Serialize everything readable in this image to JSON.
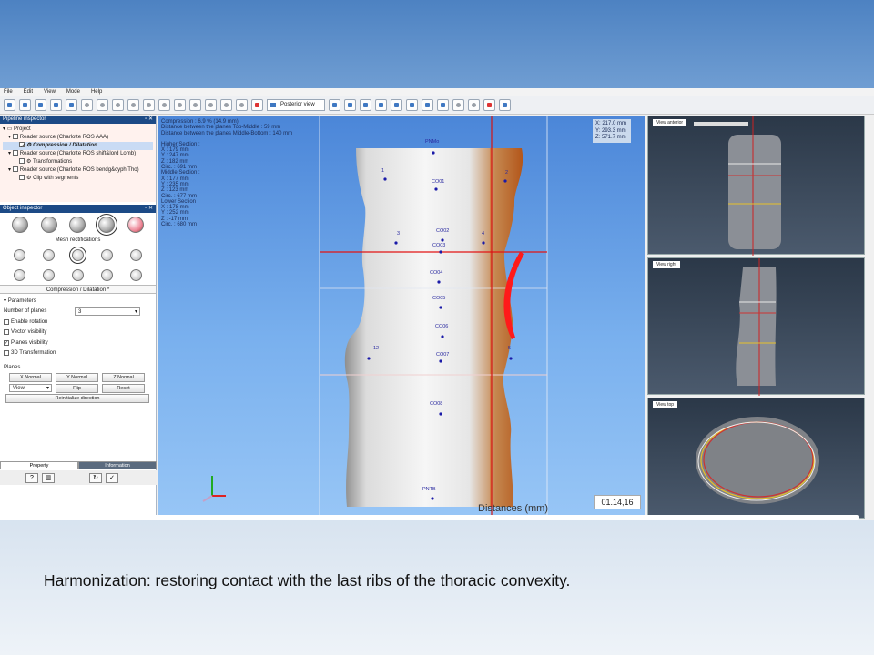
{
  "menubar": [
    "File",
    "Edit",
    "View",
    "Mode",
    "Help"
  ],
  "toolbar": {
    "view_select": "Posterior view"
  },
  "pipeline": {
    "title": "Pipeline inspector",
    "items": [
      {
        "label": "Project"
      },
      {
        "label": "Reader source (Charlotte ROS AAA)"
      },
      {
        "label": "Compression / Dilatation"
      },
      {
        "label": "Reader source (Charlotte ROS shift&lord Lomb)"
      },
      {
        "label": "Transformations"
      },
      {
        "label": "Reader source (Charlotte ROS bendg&cyph Tho)"
      },
      {
        "label": "Clip with segments"
      }
    ]
  },
  "object": {
    "title": "Object inspector",
    "mesh_label": "Mesh rectifications",
    "section_title": "Compression / Dilatation *",
    "parameters_label": "Parameters",
    "num_planes_label": "Number of planes",
    "num_planes_value": "3",
    "checks": [
      {
        "label": "Enable rotation",
        "checked": false
      },
      {
        "label": "Vector visibility",
        "checked": false
      },
      {
        "label": "Planes visibility",
        "checked": true
      },
      {
        "label": "3D Transformation",
        "checked": false
      }
    ],
    "planes_label": "Planes",
    "x_normal": "X Normal",
    "y_normal": "Y Normal",
    "z_normal": "Z Normal",
    "view_combo": "View",
    "flip": "Flip",
    "reset": "Reset",
    "reinit": "Reinitialize direction",
    "tab_property": "Property",
    "tab_information": "Information"
  },
  "overlay": {
    "lines": [
      "Compression : 6.9 % (14.9 mm)",
      "Distance between the planes Top-Middle : 59 mm",
      "Distance between the planes Middle-Bottom : 140 mm",
      "",
      "Higher Section :",
      "  X : 179 mm",
      "  Y : 247 mm",
      "  Z : 182 mm",
      "  Circ. : 691 mm",
      "Middle Section :",
      "  X : 177 mm",
      "  Y : 235 mm",
      "  Z : 123 mm",
      "  Circ. : 677 mm",
      "Lower Section :",
      "  X : 178 mm",
      "  Y : 252 mm",
      "  Z : -17 mm",
      "  Circ. : 680 mm"
    ]
  },
  "coords": {
    "x": "X: 217.0 mm",
    "y": "Y: 293.3 mm",
    "z": "Z: 571.7 mm"
  },
  "landmarks": {
    "pnm": "PNMo",
    "c0d1": "CO01",
    "c0d2": "CO02",
    "c0d3": "CO03",
    "c0d4": "CO04",
    "c0d5": "CO05",
    "c0d6": "CO06",
    "c0d7": "CO07",
    "c0d8": "CO08",
    "pntb": "PNTB",
    "n1": "1",
    "n2": "2",
    "n3": "3",
    "n4": "4",
    "n12": "12",
    "n5": "5"
  },
  "side_views": {
    "anterior": "View anterior",
    "right": "View right",
    "top": "View top"
  },
  "distances_label": "Distances (mm)",
  "timestamp": "01.14,16",
  "caption": "Harmonization: restoring contact with the last ribs of the thoracic convexity."
}
